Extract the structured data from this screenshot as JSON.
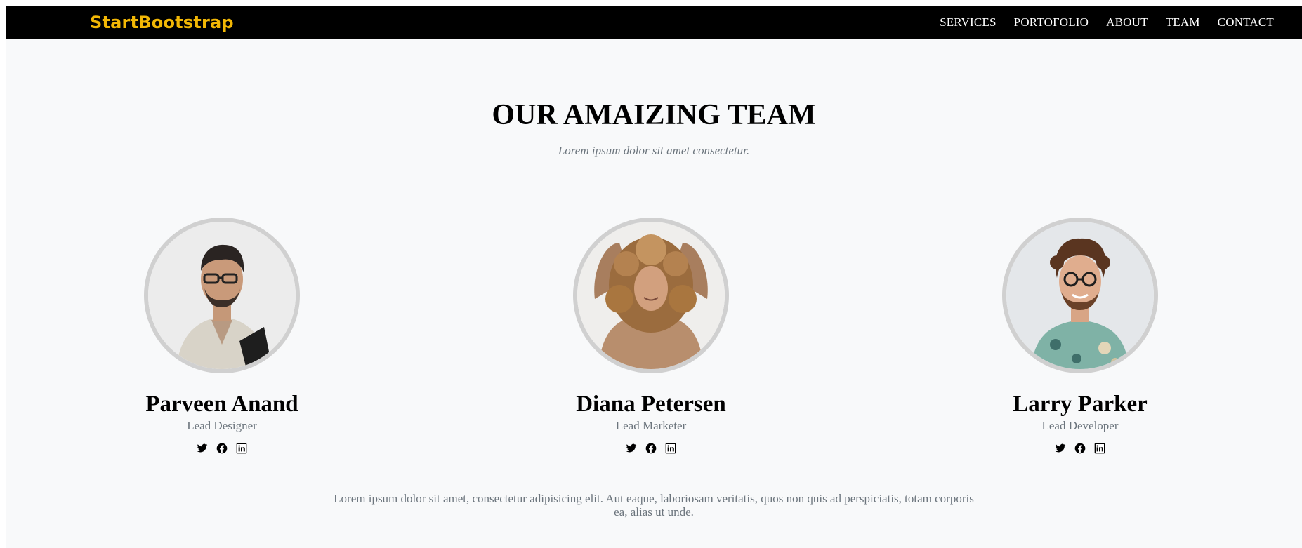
{
  "brand": {
    "name": "StartBootstrap",
    "color": "#f2b705"
  },
  "nav": {
    "items": [
      {
        "label": "SERVICES"
      },
      {
        "label": "PORTOFOLIO"
      },
      {
        "label": "ABOUT"
      },
      {
        "label": "TEAM"
      },
      {
        "label": "CONTACT"
      }
    ]
  },
  "team": {
    "title": "OUR AMAIZING TEAM",
    "subtitle": "Lorem ipsum dolor sit amet consectetur.",
    "members": [
      {
        "name": "Parveen Anand",
        "role": "Lead Designer",
        "photo": "man-with-glasses-photo",
        "socials": [
          "twitter-icon",
          "facebook-icon",
          "linkedin-icon"
        ]
      },
      {
        "name": "Diana Petersen",
        "role": "Lead Marketer",
        "photo": "woman-with-curly-hair-photo",
        "socials": [
          "twitter-icon",
          "facebook-icon",
          "linkedin-icon"
        ]
      },
      {
        "name": "Larry Parker",
        "role": "Lead Developer",
        "photo": "smiling-man-with-glasses-photo",
        "socials": [
          "twitter-icon",
          "facebook-icon",
          "linkedin-icon"
        ]
      }
    ],
    "footer_text": "Lorem ipsum dolor sit amet, consectetur adipisicing elit. Aut eaque, laboriosam veritatis, quos non quis ad perspiciatis, totam corporis ea, alias ut unde."
  },
  "colors": {
    "navbar_bg": "#000000",
    "page_bg": "#f8f9fa",
    "muted_text": "#6c757d",
    "avatar_border": "#d0d0d0"
  }
}
